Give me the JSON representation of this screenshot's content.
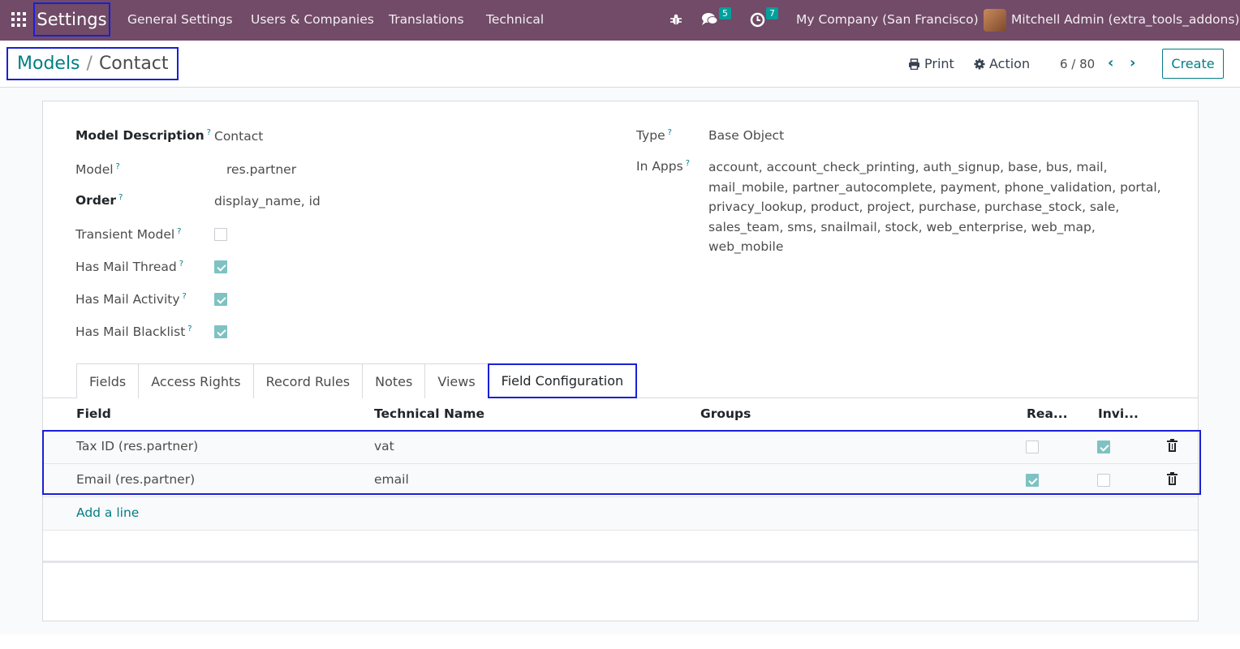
{
  "navbar": {
    "app_name": "Settings",
    "menu": [
      "General Settings",
      "Users & Companies",
      "Translations",
      "Technical"
    ],
    "messages_count": "5",
    "activities_count": "7",
    "company": "My Company (San Francisco)",
    "user": "Mitchell Admin (extra_tools_addons)"
  },
  "control": {
    "breadcrumb_parent": "Models",
    "breadcrumb_separator": "/",
    "breadcrumb_current": "Contact",
    "print_label": "Print",
    "action_label": "Action",
    "pager": "6 / 80",
    "create_label": "Create"
  },
  "form": {
    "left": [
      {
        "label": "Model Description",
        "value": "Contact",
        "bold": true
      },
      {
        "label": "Model",
        "value": "res.partner"
      },
      {
        "label": "Order",
        "value": "display_name, id",
        "bold": true
      },
      {
        "label": "Transient Model",
        "checked": false
      },
      {
        "label": "Has Mail Thread",
        "checked": true
      },
      {
        "label": "Has Mail Activity",
        "checked": true
      },
      {
        "label": "Has Mail Blacklist",
        "checked": true
      }
    ],
    "right": {
      "type_label": "Type",
      "type_value": "Base Object",
      "apps_label": "In Apps",
      "apps_value": "account, account_check_printing, auth_signup, base, bus, mail, mail_mobile, partner_autocomplete, payment, phone_validation, portal, privacy_lookup, product, project, purchase, purchase_stock, sale, sales_team, sms, snailmail, stock, web_enterprise, web_map, web_mobile"
    },
    "help_mark": "?"
  },
  "tabs": [
    "Fields",
    "Access Rights",
    "Record Rules",
    "Notes",
    "Views",
    "Field Configuration"
  ],
  "active_tab": "Field Configuration",
  "table": {
    "headers": [
      "Field",
      "Technical Name",
      "Groups",
      "Rea...",
      "Invi..."
    ],
    "rows": [
      {
        "field": "Tax ID (res.partner)",
        "technical_name": "vat",
        "groups": "",
        "readonly": false,
        "invisible": true
      },
      {
        "field": "Email (res.partner)",
        "technical_name": "email",
        "groups": "",
        "readonly": true,
        "invisible": false
      }
    ],
    "add_line": "Add a line"
  },
  "colors": {
    "navbar": "#714b67",
    "accent": "#017e84",
    "highlight": "#1a20d6"
  }
}
